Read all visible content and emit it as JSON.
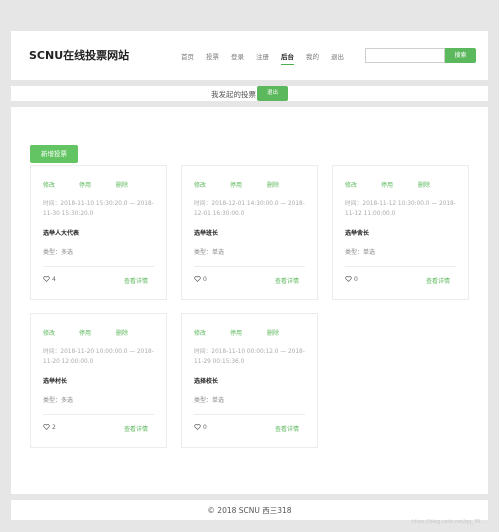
{
  "header": {
    "brand": "SCNU在线投票网站",
    "nav": [
      {
        "label": "首页"
      },
      {
        "label": "投票"
      },
      {
        "label": "登录"
      },
      {
        "label": "注册"
      },
      {
        "label": "后台",
        "active": true
      },
      {
        "label": "我的"
      },
      {
        "label": "退出"
      }
    ],
    "search_placeholder": "",
    "search_button": "搜索"
  },
  "subbar": {
    "title": "我发起的投票",
    "button": "退出"
  },
  "main": {
    "new_button": "新增投票",
    "cards": [
      {
        "actions": [
          "修改",
          "停用",
          "删除"
        ],
        "time": "时间：2018-11-10 15:30:20.0 — 2018-11-30 15:30:20.0",
        "title": "选举人大代表",
        "type": "类型：多选",
        "likes": "4",
        "details": "查看详情"
      },
      {
        "actions": [
          "修改",
          "停用",
          "删除"
        ],
        "time": "时间：2018-12-01 14:30:00.0 — 2018-12-01 16:30:00.0",
        "title": "选举班长",
        "type": "类型：单选",
        "likes": "0",
        "details": "查看详情"
      },
      {
        "actions": [
          "修改",
          "停用",
          "删除"
        ],
        "time": "时间：2018-11-12 10:30:00.0 — 2018-11-12 11:00:00.0",
        "title": "选举舍长",
        "type": "类型：单选",
        "likes": "0",
        "details": "查看详情"
      },
      {
        "actions": [
          "修改",
          "停用",
          "删除"
        ],
        "time": "时间：2018-11-20 10:00:00.0 — 2018-11-20 12:00:00.0",
        "title": "选举村长",
        "type": "类型：多选",
        "likes": "2",
        "details": "查看详情"
      },
      {
        "actions": [
          "修改",
          "停用",
          "删除"
        ],
        "time": "时间：2018-11-10 00:00:12.0 — 2018-11-29 00:15:36.0",
        "title": "选择校长",
        "type": "类型：单选",
        "likes": "0",
        "details": "查看详情"
      }
    ]
  },
  "footer": {
    "copyright": "© 2018 SCNU 西三318"
  },
  "watermark": "https://blog.csdn.net/qq_39...",
  "colors": {
    "accent": "#5cb85c",
    "background": "#e6e6e6"
  }
}
